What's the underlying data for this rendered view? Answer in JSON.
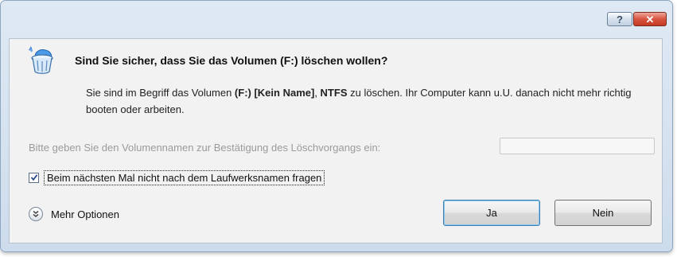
{
  "titlebar": {
    "help_label": "?",
    "close_label": "✕"
  },
  "dialog": {
    "heading": "Sind Sie sicher, dass Sie das Volumen (F:) löschen wollen?",
    "message": {
      "part1": "Sie sind im Begriff das Volumen ",
      "volume": "(F:) [Kein Name]",
      "sep": ", ",
      "fs": "NTFS",
      "part2": " zu löschen. Ihr Computer kann u.U. danach nicht mehr richtig booten oder arbeiten."
    },
    "confirm_label": "Bitte geben Sie den Volumennamen zur Bestätigung des Löschvorgangs ein:",
    "confirm_value": "",
    "checkbox": {
      "label": "Beim nächsten Mal nicht nach dem Laufwerksnamen fragen",
      "checked": true
    },
    "more_options_label": "Mehr Optionen",
    "buttons": {
      "yes": "Ja",
      "no": "Nein"
    }
  }
}
